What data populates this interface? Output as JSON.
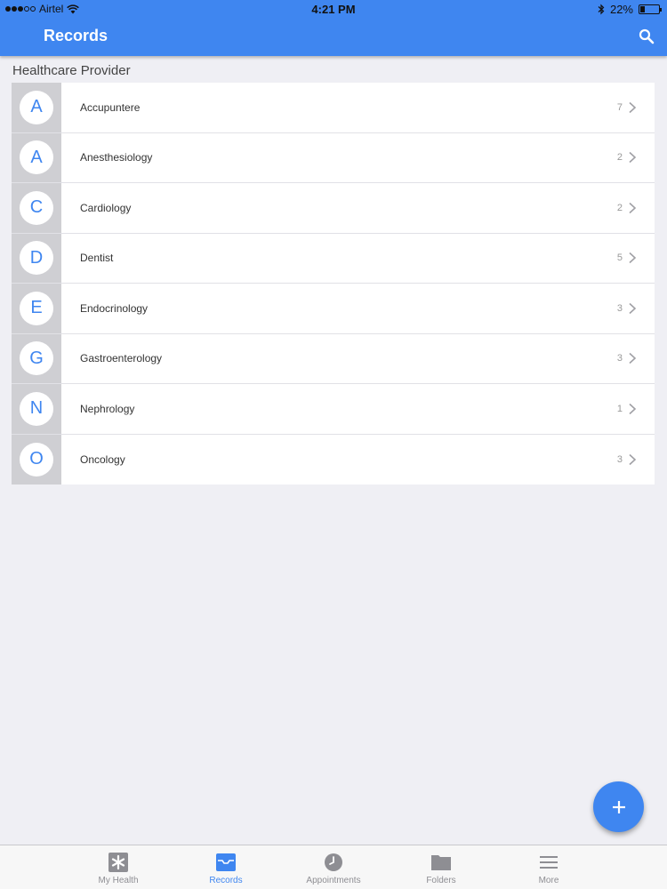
{
  "status": {
    "carrier": "Airtel",
    "time": "4:21 PM",
    "battery": "22%",
    "battery_level": 0.22
  },
  "header": {
    "title": "Records"
  },
  "section": {
    "title": "Healthcare Provider"
  },
  "items": [
    {
      "letter": "A",
      "label": "Accupuntere",
      "count": "7"
    },
    {
      "letter": "A",
      "label": "Anesthesiology",
      "count": "2"
    },
    {
      "letter": "C",
      "label": "Cardiology",
      "count": "2"
    },
    {
      "letter": "D",
      "label": "Dentist",
      "count": "5"
    },
    {
      "letter": "E",
      "label": "Endocrinology",
      "count": "3"
    },
    {
      "letter": "G",
      "label": "Gastroenterology",
      "count": "3"
    },
    {
      "letter": "N",
      "label": "Nephrology",
      "count": "1"
    },
    {
      "letter": "O",
      "label": "Oncology",
      "count": "3"
    }
  ],
  "tabs": [
    {
      "label": "My Health",
      "icon": "asterisk-icon",
      "active": false
    },
    {
      "label": "Records",
      "icon": "inbox-icon",
      "active": true
    },
    {
      "label": "Appointments",
      "icon": "clock-icon",
      "active": false
    },
    {
      "label": "Folders",
      "icon": "folder-icon",
      "active": false
    },
    {
      "label": "More",
      "icon": "menu-icon",
      "active": false
    }
  ],
  "colors": {
    "accent": "#3f86f0",
    "inactive_tab": "#8e8e93"
  }
}
